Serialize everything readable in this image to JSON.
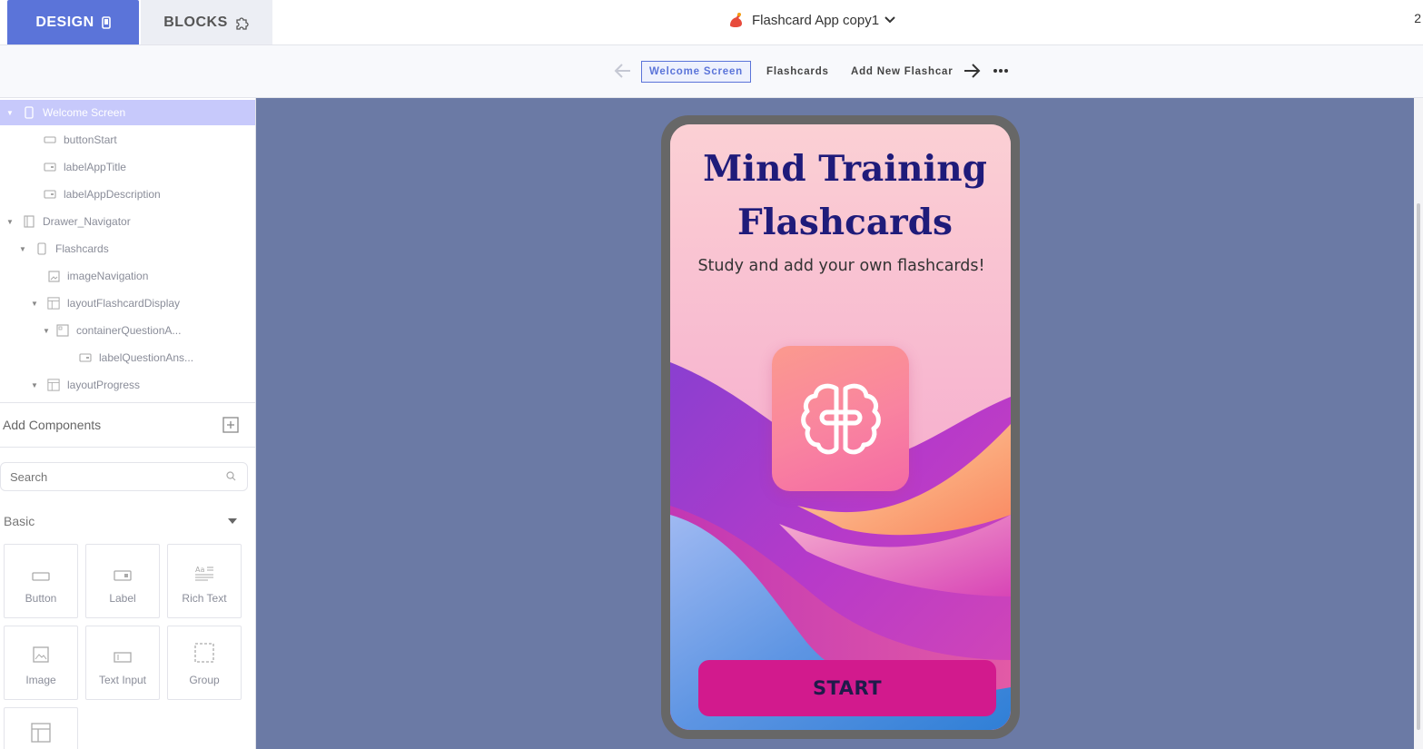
{
  "top_tabs": {
    "design": "DESIGN",
    "blocks": "BLOCKS"
  },
  "project": {
    "name": "Flashcard App copy1"
  },
  "screen_tabs": [
    "Welcome Screen",
    "Flashcards",
    "Add New Flashcar"
  ],
  "tree": [
    {
      "label": "Welcome Screen",
      "icon": "phone-icon"
    },
    {
      "label": "buttonStart",
      "icon": "button-icon"
    },
    {
      "label": "labelAppTitle",
      "icon": "label-icon"
    },
    {
      "label": "labelAppDescription",
      "icon": "label-icon"
    },
    {
      "label": "Drawer_Navigator",
      "icon": "drawer-icon"
    },
    {
      "label": "Flashcards",
      "icon": "phone-icon"
    },
    {
      "label": "imageNavigation",
      "icon": "image-icon"
    },
    {
      "label": "layoutFlashcardDisplay",
      "icon": "layout-icon"
    },
    {
      "label": "containerQuestionA...",
      "icon": "container-icon"
    },
    {
      "label": "labelQuestionAns...",
      "icon": "label-icon"
    },
    {
      "label": "layoutProgress",
      "icon": "layout-icon"
    }
  ],
  "add_components": {
    "title": "Add Components"
  },
  "search": {
    "placeholder": "Search"
  },
  "basic": {
    "title": "Basic"
  },
  "components": [
    "Button",
    "Label",
    "Rich Text",
    "Image",
    "Text Input",
    "Group"
  ],
  "app": {
    "title": "Mind Training Flashcards",
    "description": "Study and add your own flashcards!",
    "start_label": "START"
  },
  "colors": {
    "accent": "#5b74d9",
    "canvas": "#6b7aa5",
    "title": "#1f1b7a",
    "start_button": "#d21a8d",
    "tree_selected": "#c7c9fb"
  }
}
